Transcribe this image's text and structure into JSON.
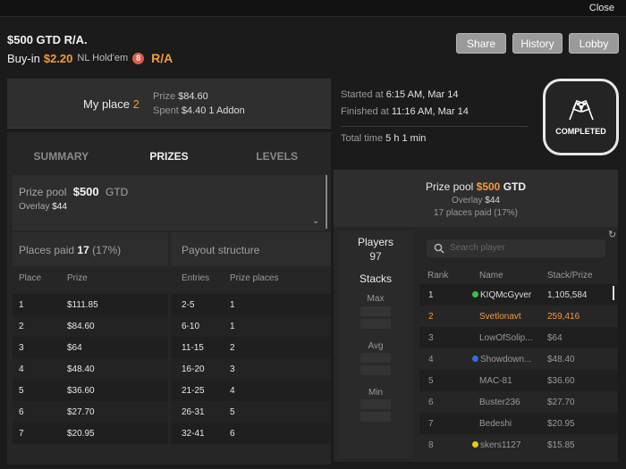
{
  "topbar": {
    "close_label": "Close"
  },
  "tournament": {
    "title": "$500 GTD R/A.",
    "buyin_label": "Buy-in",
    "buyin_amount": "$2.20",
    "game": "NL Hold'em",
    "badge": "8",
    "ra_tag": "R/A"
  },
  "buttons": {
    "share": "Share",
    "history": "History",
    "lobby": "Lobby"
  },
  "my_place": {
    "label": "My place",
    "value": "2",
    "prize_label": "Prize",
    "prize_value": "$84.60",
    "spent_label": "Spent",
    "spent_value": "$4.40",
    "addon": "1 Addon"
  },
  "timing": {
    "started_label": "Started at",
    "started_value": "6:15 AM, Mar 14",
    "finished_label": "Finished at",
    "finished_value": "11:16 AM, Mar 14",
    "total_label": "Total time",
    "total_value": "5 h 1 min"
  },
  "status": {
    "completed_label": "COMPLETED"
  },
  "tabs": [
    "SUMMARY",
    "PRIZES",
    "LEVELS"
  ],
  "prize_pool": {
    "label": "Prize pool",
    "value": "$500",
    "suffix": "GTD",
    "overlay_label": "Overlay",
    "overlay_value": "$44"
  },
  "places_paid": {
    "label": "Places paid",
    "value": "17",
    "pct": "(17%)"
  },
  "payout_structure": {
    "label": "Payout structure"
  },
  "prize_table": {
    "headers": [
      "Place",
      "Prize"
    ],
    "rows": [
      [
        "1",
        "$111.85"
      ],
      [
        "2",
        "$84.60"
      ],
      [
        "3",
        "$64"
      ],
      [
        "4",
        "$48.40"
      ],
      [
        "5",
        "$36.60"
      ],
      [
        "6",
        "$27.70"
      ],
      [
        "7",
        "$20.95"
      ]
    ]
  },
  "payout_table": {
    "headers": [
      "Entries",
      "Prize places"
    ],
    "rows": [
      [
        "2-5",
        "1"
      ],
      [
        "6-10",
        "1"
      ],
      [
        "11-15",
        "2"
      ],
      [
        "16-20",
        "3"
      ],
      [
        "21-25",
        "4"
      ],
      [
        "26-31",
        "5"
      ],
      [
        "32-41",
        "6"
      ]
    ]
  },
  "right_header": {
    "title": "Prize pool",
    "value": "$500",
    "suffix": "GTD",
    "overlay_label": "Overlay",
    "overlay_value": "$44",
    "paid": "17 places paid (17%)"
  },
  "stats": {
    "players_label": "Players",
    "players_value": "97",
    "stacks_label": "Stacks",
    "max_label": "Max",
    "avg_label": "Avg",
    "min_label": "Min"
  },
  "search": {
    "placeholder": "Search player"
  },
  "players_table": {
    "headers": [
      "Rank",
      "Name",
      "Stack/Prize"
    ],
    "rows": [
      {
        "rank": "1",
        "name": "KIQMcGyver",
        "value": "1,105,584",
        "dot": "#38c24a"
      },
      {
        "rank": "2",
        "name": "Svetlonavt",
        "value": "259,416",
        "dot": ""
      },
      {
        "rank": "3",
        "name": "LowOfSolip...",
        "value": "$64",
        "dot": ""
      },
      {
        "rank": "4",
        "name": "Showdown...",
        "value": "$48.40",
        "dot": "#3b6ae0"
      },
      {
        "rank": "5",
        "name": "MAC-81",
        "value": "$36.60",
        "dot": ""
      },
      {
        "rank": "6",
        "name": "Buster236",
        "value": "$27.70",
        "dot": ""
      },
      {
        "rank": "7",
        "name": "Bedeshi",
        "value": "$20.95",
        "dot": ""
      },
      {
        "rank": "8",
        "name": "skers1127",
        "value": "$15.85",
        "dot": "#e5c820"
      }
    ]
  }
}
